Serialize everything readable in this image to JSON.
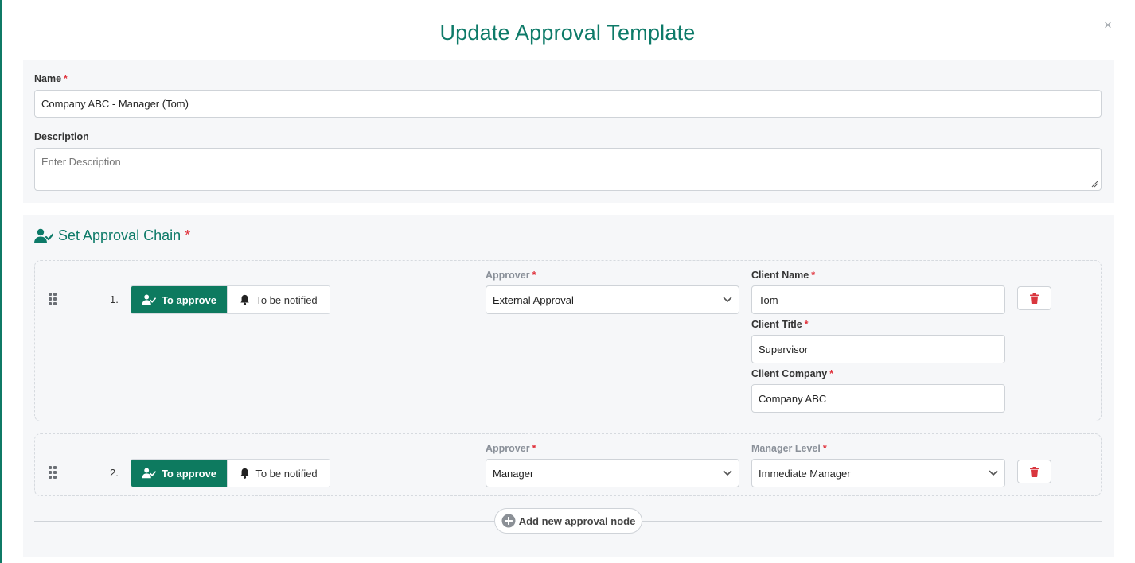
{
  "dialog": {
    "title": "Update Approval Template",
    "close_label": "×"
  },
  "form": {
    "name_label": "Name",
    "name_value": "Company ABC - Manager (Tom)",
    "description_label": "Description",
    "description_placeholder": "Enter Description",
    "required_mark": "*"
  },
  "chain": {
    "title": "Set Approval Chain",
    "nodes": [
      {
        "number": "1.",
        "mode_active": "To approve",
        "mode_inactive": "To be notified",
        "approver_label": "Approver",
        "approver_value": "External Approval",
        "client_name_label": "Client Name",
        "client_name_value": "Tom",
        "client_title_label": "Client Title",
        "client_title_value": "Supervisor",
        "client_company_label": "Client Company",
        "client_company_value": "Company ABC"
      },
      {
        "number": "2.",
        "mode_active": "To approve",
        "mode_inactive": "To be notified",
        "approver_label": "Approver",
        "approver_value": "Manager",
        "manager_level_label": "Manager Level",
        "manager_level_value": "Immediate Manager"
      }
    ],
    "add_label": "Add new approval node"
  },
  "colors": {
    "accent": "#0d7a68",
    "active_toggle": "#0d7a5f",
    "required": "#e0303a",
    "delete_icon": "#d9363e",
    "panel_bg": "#f6f7f9"
  },
  "icons": {
    "user_check": "user-check-icon",
    "bell": "bell-icon",
    "chevron": "chevron-down-icon",
    "trash": "trash-icon",
    "drag": "drag-handle-icon",
    "plus": "plus-circle-icon",
    "close": "close-icon"
  }
}
